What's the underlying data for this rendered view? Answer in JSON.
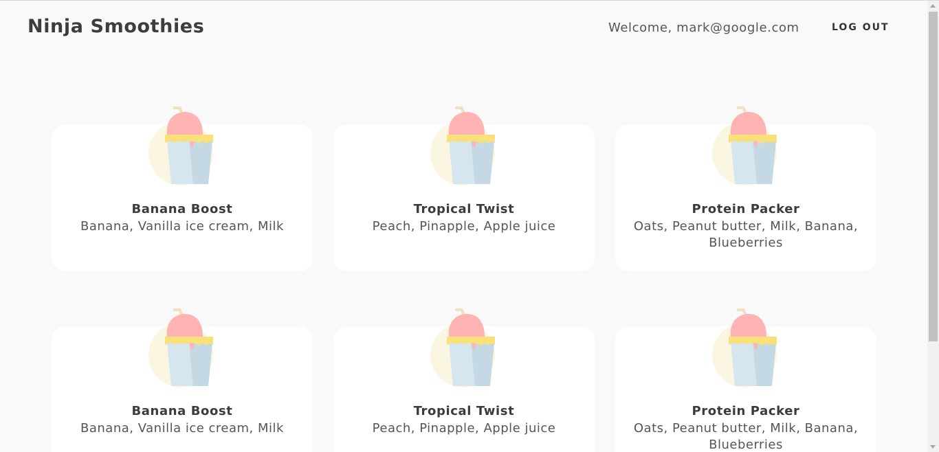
{
  "navbar": {
    "brand": "Ninja Smoothies",
    "welcome": "Welcome, mark@google.com",
    "logout_label": "LOG OUT"
  },
  "smoothies": [
    {
      "title": "Banana Boost",
      "ingredients": "Banana, Vanilla ice cream, Milk",
      "icon": "smoothie-cup-icon"
    },
    {
      "title": "Tropical Twist",
      "ingredients": "Peach, Pinapple, Apple juice",
      "icon": "smoothie-cup-icon"
    },
    {
      "title": "Protein Packer",
      "ingredients": "Oats, Peanut butter, Milk, Banana, Blueberries",
      "icon": "smoothie-cup-icon"
    },
    {
      "title": "Banana Boost",
      "ingredients": "Banana, Vanilla ice cream, Milk",
      "icon": "smoothie-cup-icon"
    },
    {
      "title": "Tropical Twist",
      "ingredients": "Peach, Pinapple, Apple juice",
      "icon": "smoothie-cup-icon"
    },
    {
      "title": "Protein Packer",
      "ingredients": "Oats, Peanut butter, Milk, Banana, Blueberries",
      "icon": "smoothie-cup-icon"
    }
  ],
  "colors": {
    "background": "#f9f9f9",
    "card": "#ffffff",
    "cup": "#d6e6ee",
    "cup_shade": "#c4d9e3",
    "topping": "#ffb3b3",
    "rim": "#f9e07a",
    "glow": "#fbf6e2",
    "straw": "#efe2c2"
  }
}
